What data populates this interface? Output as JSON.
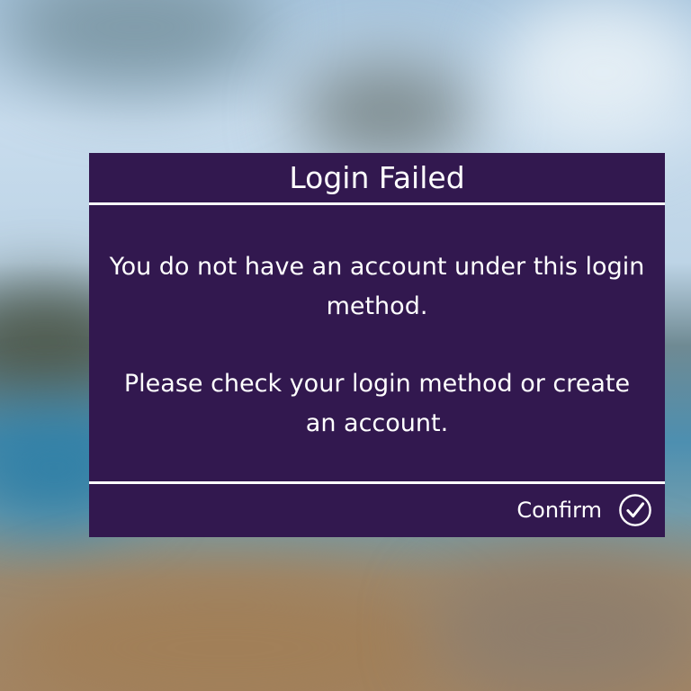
{
  "dialog": {
    "title": "Login Failed",
    "message_line_1": "You do not have an account under this login method.",
    "message_line_2": "Please check your login method or create an account.",
    "confirm_label": "Confirm",
    "confirm_icon": "checkmark-circle-icon"
  },
  "colors": {
    "dialog_background": "#32184f",
    "text": "#ffffff"
  }
}
